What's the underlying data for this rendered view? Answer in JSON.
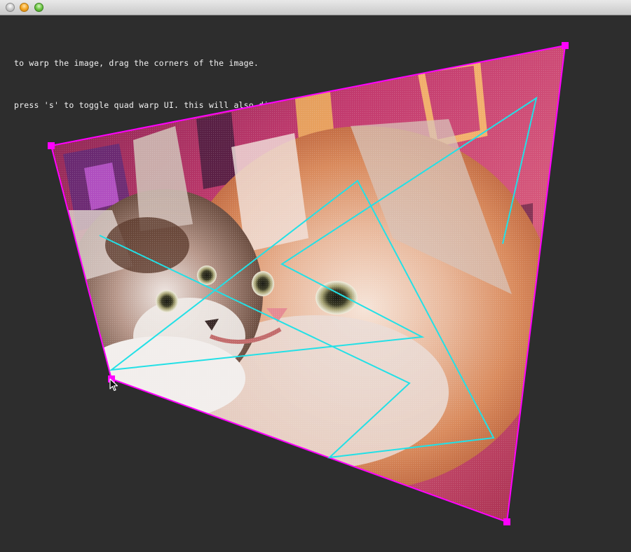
{
  "window": {
    "title": "",
    "controls": [
      "close-button",
      "minimize-button",
      "zoom-button"
    ]
  },
  "instructions": {
    "line1": "to warp the image, drag the corners of the image.",
    "line2": "press 's' to toggle quad warp UI. this will also disable quad warp interaction."
  },
  "colors": {
    "background": "#2d2d2d",
    "quad_outline": "#ff00ff",
    "corner_handle": "#ff00ff",
    "overlay_line": "#22e0e6"
  },
  "image": {
    "subject": "two kittens (tabby and orange-white) on a pink/red patterned background"
  }
}
